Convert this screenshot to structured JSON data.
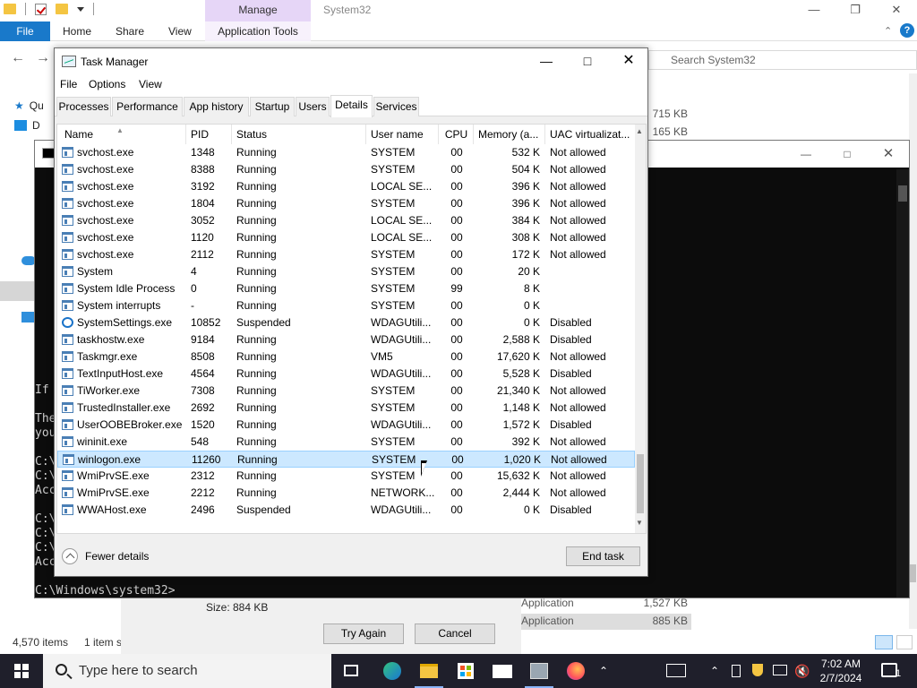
{
  "explorer": {
    "window_title": "System32",
    "context_tab": "Manage",
    "ribbon_tabs": [
      "File",
      "Home",
      "Share",
      "View",
      "Application Tools"
    ],
    "search_placeholder": "Search System32",
    "nav_items": [
      "Qu",
      "D"
    ],
    "sizes_top": [
      "715 KB",
      "165 KB"
    ],
    "detail_rows": [
      {
        "type": "Application",
        "size": "1,527 KB"
      },
      {
        "type": "Application",
        "size": "885 KB"
      }
    ],
    "status_left": "4,570 items",
    "status_mid": "1 item s"
  },
  "cmd": {
    "lines": [
      {
        "text": "If"
      },
      {
        "text": "The"
      },
      {
        "text": "you"
      },
      {
        "text": "C:\\"
      },
      {
        "text": "C:\\"
      },
      {
        "text": "Acc"
      },
      {
        "text": "C:\\"
      },
      {
        "text": "C:\\"
      },
      {
        "text": "C:\\"
      },
      {
        "text": "Acc"
      },
      {
        "text": "C:\\Windows\\system32>"
      }
    ]
  },
  "dialog": {
    "size_text": "Size: 884 KB",
    "try_again": "Try Again",
    "cancel": "Cancel"
  },
  "taskmgr": {
    "title": "Task Manager",
    "menu": [
      "File",
      "Options",
      "View"
    ],
    "tabs": [
      "Processes",
      "Performance",
      "App history",
      "Startup",
      "Users",
      "Details",
      "Services"
    ],
    "active_tab": "Details",
    "columns": [
      "Name",
      "PID",
      "Status",
      "User name",
      "CPU",
      "Memory (a...",
      "UAC virtualizat..."
    ],
    "rows": [
      {
        "name": "svchost.exe",
        "pid": "1348",
        "status": "Running",
        "user": "SYSTEM",
        "cpu": "00",
        "mem": "532 K",
        "uac": "Not allowed",
        "icon": "service-icon"
      },
      {
        "name": "svchost.exe",
        "pid": "8388",
        "status": "Running",
        "user": "SYSTEM",
        "cpu": "00",
        "mem": "504 K",
        "uac": "Not allowed",
        "icon": "service-icon"
      },
      {
        "name": "svchost.exe",
        "pid": "3192",
        "status": "Running",
        "user": "LOCAL SE...",
        "cpu": "00",
        "mem": "396 K",
        "uac": "Not allowed",
        "icon": "service-icon"
      },
      {
        "name": "svchost.exe",
        "pid": "1804",
        "status": "Running",
        "user": "SYSTEM",
        "cpu": "00",
        "mem": "396 K",
        "uac": "Not allowed",
        "icon": "service-icon"
      },
      {
        "name": "svchost.exe",
        "pid": "3052",
        "status": "Running",
        "user": "LOCAL SE...",
        "cpu": "00",
        "mem": "384 K",
        "uac": "Not allowed",
        "icon": "service-icon"
      },
      {
        "name": "svchost.exe",
        "pid": "1120",
        "status": "Running",
        "user": "LOCAL SE...",
        "cpu": "00",
        "mem": "308 K",
        "uac": "Not allowed",
        "icon": "service-icon"
      },
      {
        "name": "svchost.exe",
        "pid": "2112",
        "status": "Running",
        "user": "SYSTEM",
        "cpu": "00",
        "mem": "172 K",
        "uac": "Not allowed",
        "icon": "service-icon"
      },
      {
        "name": "System",
        "pid": "4",
        "status": "Running",
        "user": "SYSTEM",
        "cpu": "00",
        "mem": "20 K",
        "uac": "",
        "icon": "process-icon"
      },
      {
        "name": "System Idle Process",
        "pid": "0",
        "status": "Running",
        "user": "SYSTEM",
        "cpu": "99",
        "mem": "8 K",
        "uac": "",
        "icon": "process-icon"
      },
      {
        "name": "System interrupts",
        "pid": "-",
        "status": "Running",
        "user": "SYSTEM",
        "cpu": "00",
        "mem": "0 K",
        "uac": "",
        "icon": "process-icon"
      },
      {
        "name": "SystemSettings.exe",
        "pid": "10852",
        "status": "Suspended",
        "user": "WDAGUtili...",
        "cpu": "00",
        "mem": "0 K",
        "uac": "Disabled",
        "icon": "gear-icon"
      },
      {
        "name": "taskhostw.exe",
        "pid": "9184",
        "status": "Running",
        "user": "WDAGUtili...",
        "cpu": "00",
        "mem": "2,588 K",
        "uac": "Disabled",
        "icon": "process-icon"
      },
      {
        "name": "Taskmgr.exe",
        "pid": "8508",
        "status": "Running",
        "user": "VM5",
        "cpu": "00",
        "mem": "17,620 K",
        "uac": "Not allowed",
        "icon": "taskmgr-icon"
      },
      {
        "name": "TextInputHost.exe",
        "pid": "4564",
        "status": "Running",
        "user": "WDAGUtili...",
        "cpu": "00",
        "mem": "5,528 K",
        "uac": "Disabled",
        "icon": "process-icon"
      },
      {
        "name": "TiWorker.exe",
        "pid": "7308",
        "status": "Running",
        "user": "SYSTEM",
        "cpu": "00",
        "mem": "21,340 K",
        "uac": "Not allowed",
        "icon": "process-icon"
      },
      {
        "name": "TrustedInstaller.exe",
        "pid": "2692",
        "status": "Running",
        "user": "SYSTEM",
        "cpu": "00",
        "mem": "1,148 K",
        "uac": "Not allowed",
        "icon": "process-icon"
      },
      {
        "name": "UserOOBEBroker.exe",
        "pid": "1520",
        "status": "Running",
        "user": "WDAGUtili...",
        "cpu": "00",
        "mem": "1,572 K",
        "uac": "Disabled",
        "icon": "process-icon"
      },
      {
        "name": "wininit.exe",
        "pid": "548",
        "status": "Running",
        "user": "SYSTEM",
        "cpu": "00",
        "mem": "392 K",
        "uac": "Not allowed",
        "icon": "process-icon"
      },
      {
        "name": "winlogon.exe",
        "pid": "11260",
        "status": "Running",
        "user": "SYSTEM",
        "cpu": "00",
        "mem": "1,020 K",
        "uac": "Not allowed",
        "icon": "process-icon",
        "selected": true
      },
      {
        "name": "WmiPrvSE.exe",
        "pid": "2312",
        "status": "Running",
        "user": "SYSTEM",
        "cpu": "00",
        "mem": "15,632 K",
        "uac": "Not allowed",
        "icon": "wmi-icon"
      },
      {
        "name": "WmiPrvSE.exe",
        "pid": "2212",
        "status": "Running",
        "user": "NETWORK...",
        "cpu": "00",
        "mem": "2,444 K",
        "uac": "Not allowed",
        "icon": "wmi-icon"
      },
      {
        "name": "WWAHost.exe",
        "pid": "2496",
        "status": "Suspended",
        "user": "WDAGUtili...",
        "cpu": "00",
        "mem": "0 K",
        "uac": "Disabled",
        "icon": "process-icon"
      }
    ],
    "fewer_details": "Fewer details",
    "end_task": "End task"
  },
  "taskbar": {
    "search_placeholder": "Type here to search",
    "apps": [
      "task-view-icon",
      "edge-icon",
      "file-explorer-icon",
      "store-icon",
      "mail-icon",
      "network-drive-icon",
      "firefox-icon"
    ],
    "time": "7:02 AM",
    "date": "2/7/2024",
    "notification_count": "1"
  },
  "colors": {
    "selection": "#cce8ff",
    "accent": "#1979ca",
    "manage_tab": "#e6d6f7",
    "taskbar": "#1f1f2b"
  }
}
